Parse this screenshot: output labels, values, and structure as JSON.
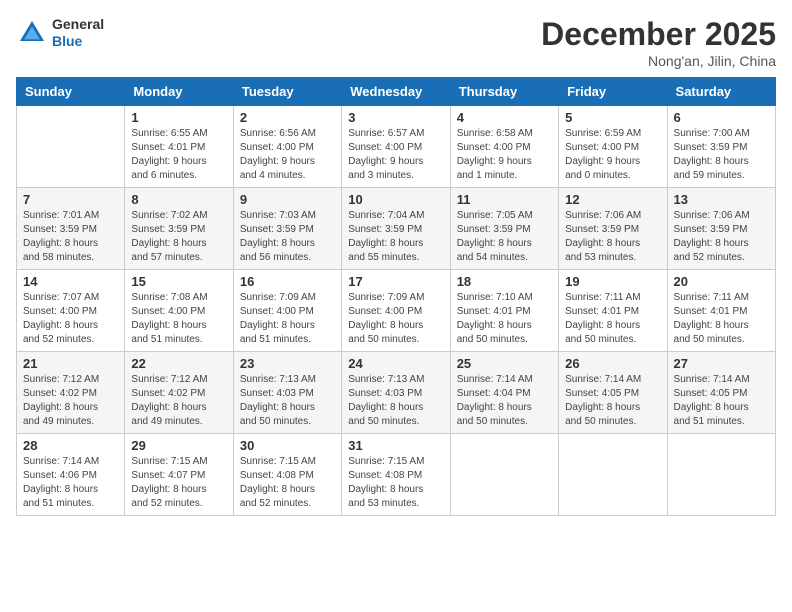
{
  "header": {
    "logo_general": "General",
    "logo_blue": "Blue",
    "month_title": "December 2025",
    "subtitle": "Nong'an, Jilin, China"
  },
  "weekdays": [
    "Sunday",
    "Monday",
    "Tuesday",
    "Wednesday",
    "Thursday",
    "Friday",
    "Saturday"
  ],
  "weeks": [
    [
      {
        "day": "",
        "info": ""
      },
      {
        "day": "1",
        "info": "Sunrise: 6:55 AM\nSunset: 4:01 PM\nDaylight: 9 hours\nand 6 minutes."
      },
      {
        "day": "2",
        "info": "Sunrise: 6:56 AM\nSunset: 4:00 PM\nDaylight: 9 hours\nand 4 minutes."
      },
      {
        "day": "3",
        "info": "Sunrise: 6:57 AM\nSunset: 4:00 PM\nDaylight: 9 hours\nand 3 minutes."
      },
      {
        "day": "4",
        "info": "Sunrise: 6:58 AM\nSunset: 4:00 PM\nDaylight: 9 hours\nand 1 minute."
      },
      {
        "day": "5",
        "info": "Sunrise: 6:59 AM\nSunset: 4:00 PM\nDaylight: 9 hours\nand 0 minutes."
      },
      {
        "day": "6",
        "info": "Sunrise: 7:00 AM\nSunset: 3:59 PM\nDaylight: 8 hours\nand 59 minutes."
      }
    ],
    [
      {
        "day": "7",
        "info": "Sunrise: 7:01 AM\nSunset: 3:59 PM\nDaylight: 8 hours\nand 58 minutes."
      },
      {
        "day": "8",
        "info": "Sunrise: 7:02 AM\nSunset: 3:59 PM\nDaylight: 8 hours\nand 57 minutes."
      },
      {
        "day": "9",
        "info": "Sunrise: 7:03 AM\nSunset: 3:59 PM\nDaylight: 8 hours\nand 56 minutes."
      },
      {
        "day": "10",
        "info": "Sunrise: 7:04 AM\nSunset: 3:59 PM\nDaylight: 8 hours\nand 55 minutes."
      },
      {
        "day": "11",
        "info": "Sunrise: 7:05 AM\nSunset: 3:59 PM\nDaylight: 8 hours\nand 54 minutes."
      },
      {
        "day": "12",
        "info": "Sunrise: 7:06 AM\nSunset: 3:59 PM\nDaylight: 8 hours\nand 53 minutes."
      },
      {
        "day": "13",
        "info": "Sunrise: 7:06 AM\nSunset: 3:59 PM\nDaylight: 8 hours\nand 52 minutes."
      }
    ],
    [
      {
        "day": "14",
        "info": "Sunrise: 7:07 AM\nSunset: 4:00 PM\nDaylight: 8 hours\nand 52 minutes."
      },
      {
        "day": "15",
        "info": "Sunrise: 7:08 AM\nSunset: 4:00 PM\nDaylight: 8 hours\nand 51 minutes."
      },
      {
        "day": "16",
        "info": "Sunrise: 7:09 AM\nSunset: 4:00 PM\nDaylight: 8 hours\nand 51 minutes."
      },
      {
        "day": "17",
        "info": "Sunrise: 7:09 AM\nSunset: 4:00 PM\nDaylight: 8 hours\nand 50 minutes."
      },
      {
        "day": "18",
        "info": "Sunrise: 7:10 AM\nSunset: 4:01 PM\nDaylight: 8 hours\nand 50 minutes."
      },
      {
        "day": "19",
        "info": "Sunrise: 7:11 AM\nSunset: 4:01 PM\nDaylight: 8 hours\nand 50 minutes."
      },
      {
        "day": "20",
        "info": "Sunrise: 7:11 AM\nSunset: 4:01 PM\nDaylight: 8 hours\nand 50 minutes."
      }
    ],
    [
      {
        "day": "21",
        "info": "Sunrise: 7:12 AM\nSunset: 4:02 PM\nDaylight: 8 hours\nand 49 minutes."
      },
      {
        "day": "22",
        "info": "Sunrise: 7:12 AM\nSunset: 4:02 PM\nDaylight: 8 hours\nand 49 minutes."
      },
      {
        "day": "23",
        "info": "Sunrise: 7:13 AM\nSunset: 4:03 PM\nDaylight: 8 hours\nand 50 minutes."
      },
      {
        "day": "24",
        "info": "Sunrise: 7:13 AM\nSunset: 4:03 PM\nDaylight: 8 hours\nand 50 minutes."
      },
      {
        "day": "25",
        "info": "Sunrise: 7:14 AM\nSunset: 4:04 PM\nDaylight: 8 hours\nand 50 minutes."
      },
      {
        "day": "26",
        "info": "Sunrise: 7:14 AM\nSunset: 4:05 PM\nDaylight: 8 hours\nand 50 minutes."
      },
      {
        "day": "27",
        "info": "Sunrise: 7:14 AM\nSunset: 4:05 PM\nDaylight: 8 hours\nand 51 minutes."
      }
    ],
    [
      {
        "day": "28",
        "info": "Sunrise: 7:14 AM\nSunset: 4:06 PM\nDaylight: 8 hours\nand 51 minutes."
      },
      {
        "day": "29",
        "info": "Sunrise: 7:15 AM\nSunset: 4:07 PM\nDaylight: 8 hours\nand 52 minutes."
      },
      {
        "day": "30",
        "info": "Sunrise: 7:15 AM\nSunset: 4:08 PM\nDaylight: 8 hours\nand 52 minutes."
      },
      {
        "day": "31",
        "info": "Sunrise: 7:15 AM\nSunset: 4:08 PM\nDaylight: 8 hours\nand 53 minutes."
      },
      {
        "day": "",
        "info": ""
      },
      {
        "day": "",
        "info": ""
      },
      {
        "day": "",
        "info": ""
      }
    ]
  ]
}
